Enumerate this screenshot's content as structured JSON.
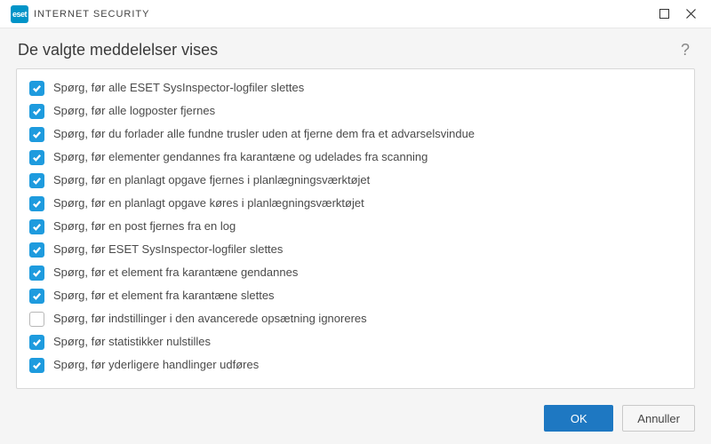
{
  "titlebar": {
    "logo_badge": "eset",
    "product_name": "INTERNET SECURITY"
  },
  "header": {
    "title": "De valgte meddelelser vises",
    "help_label": "?"
  },
  "notifications": [
    {
      "checked": true,
      "label": "Spørg, før alle ESET SysInspector-logfiler slettes"
    },
    {
      "checked": true,
      "label": "Spørg, før alle logposter fjernes"
    },
    {
      "checked": true,
      "label": "Spørg, før du forlader alle fundne trusler uden at fjerne dem fra et advarselsvindue"
    },
    {
      "checked": true,
      "label": "Spørg, før elementer gendannes fra karantæne og udelades fra scanning"
    },
    {
      "checked": true,
      "label": "Spørg, før en planlagt opgave fjernes i planlægningsværktøjet"
    },
    {
      "checked": true,
      "label": "Spørg, før en planlagt opgave køres i planlægningsværktøjet"
    },
    {
      "checked": true,
      "label": "Spørg, før en post fjernes fra en log"
    },
    {
      "checked": true,
      "label": "Spørg, før ESET SysInspector-logfiler slettes"
    },
    {
      "checked": true,
      "label": "Spørg, før et element fra karantæne gendannes"
    },
    {
      "checked": true,
      "label": "Spørg, før et element fra karantæne slettes"
    },
    {
      "checked": false,
      "label": "Spørg, før indstillinger i den avancerede opsætning ignoreres"
    },
    {
      "checked": true,
      "label": "Spørg, før statistikker nulstilles"
    },
    {
      "checked": true,
      "label": "Spørg, før yderligere handlinger udføres"
    }
  ],
  "footer": {
    "ok_label": "OK",
    "cancel_label": "Annuller"
  }
}
